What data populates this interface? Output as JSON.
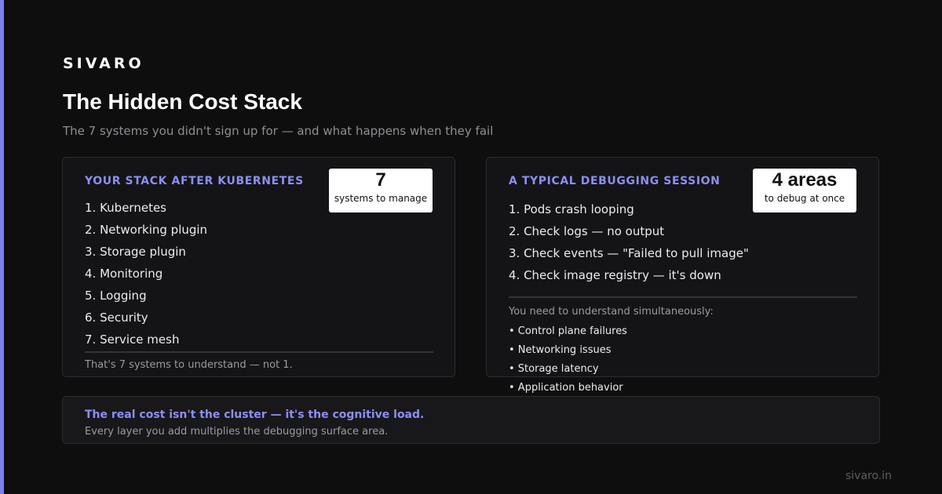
{
  "brand": "SIVARO",
  "title": "The Hidden Cost Stack",
  "subtitle": "The 7 systems you didn't sign up for — and what happens when they fail",
  "colors": {
    "accent": "#7b7ff0",
    "heading": "#8b8ff5",
    "background": "#0e0e0f"
  },
  "stack_card": {
    "heading": "YOUR STACK AFTER KUBERNETES",
    "stat_value": "7",
    "stat_caption": "systems to manage",
    "items": [
      "1. Kubernetes",
      "2. Networking plugin",
      "3. Storage plugin",
      "4. Monitoring",
      "5. Logging",
      "6. Security",
      "7. Service mesh"
    ],
    "footnote": "That's 7 systems to understand — not 1."
  },
  "debug_card": {
    "heading": "A TYPICAL DEBUGGING SESSION",
    "stat_value": "4 areas",
    "stat_caption": "to debug at once",
    "steps": [
      "1. Pods crash looping",
      "2. Check logs — no output",
      "3. Check events — \"Failed to pull image\"",
      "4. Check image registry — it's down"
    ],
    "understand_intro": "You need to understand simultaneously:",
    "areas": [
      "• Control plane failures",
      "• Networking issues",
      "• Storage latency",
      "• Application behavior"
    ]
  },
  "callout": {
    "headline": "The real cost isn't the cluster — it's the cognitive load.",
    "sub": "Every layer you add multiplies the debugging surface area."
  },
  "site": "sivaro.in"
}
